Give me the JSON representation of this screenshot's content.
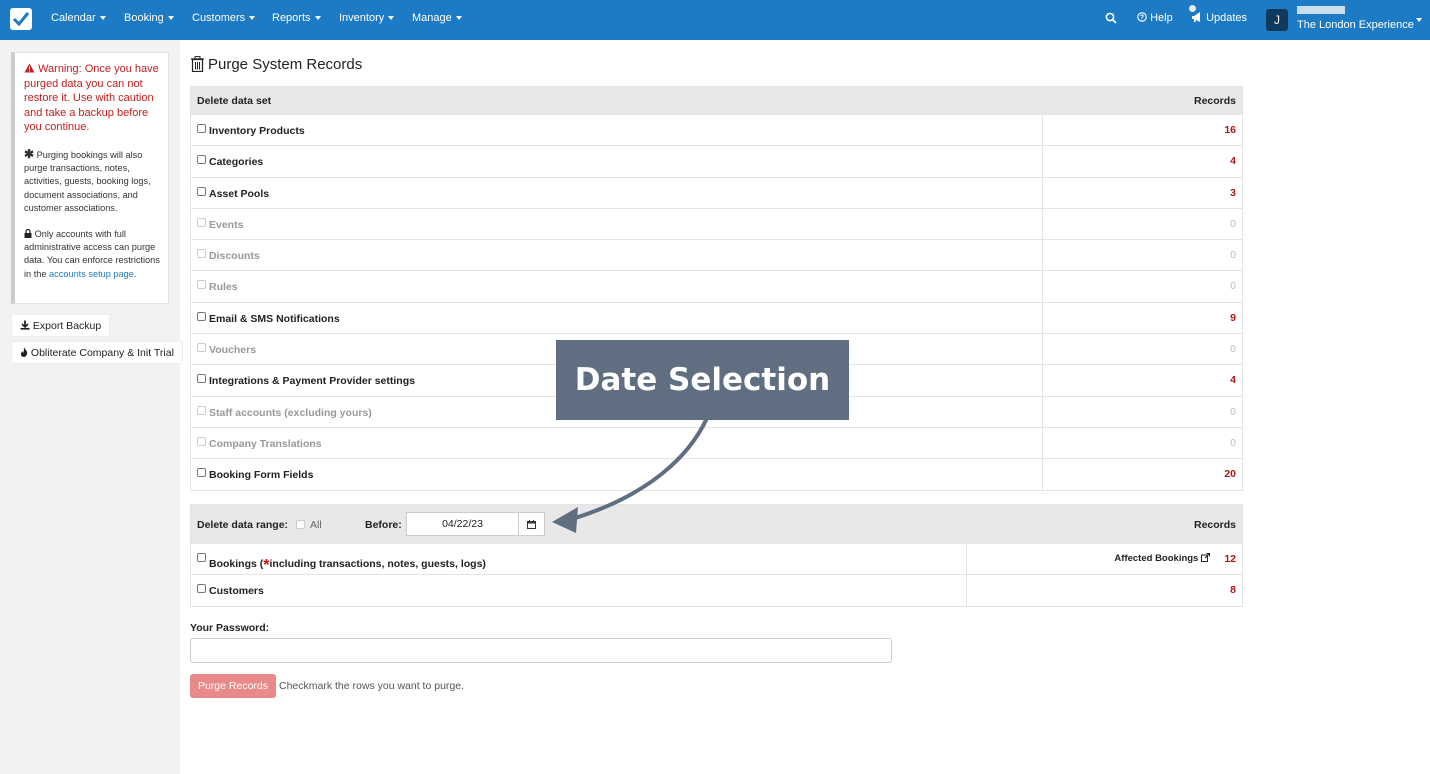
{
  "nav": {
    "items": [
      {
        "label": "Calendar"
      },
      {
        "label": "Booking"
      },
      {
        "label": "Customers"
      },
      {
        "label": "Reports"
      },
      {
        "label": "Inventory"
      },
      {
        "label": "Manage"
      }
    ],
    "help": "Help",
    "updates": "Updates",
    "avatar_initial": "J",
    "company": "The London Experience"
  },
  "sidebar": {
    "warning": "Warning: Once you have purged data you can not restore it. Use with caution and take a backup before you continue.",
    "note1": "Purging bookings will also purge transactions, notes, activities, guests, booking logs, document associations, and customer associations.",
    "note2_prefix": "Only accounts with full administrative access can purge data. You can enforce restrictions in the",
    "note2_link": "accounts setup page",
    "note2_suffix": ".",
    "export_label": "Export Backup",
    "obliterate_label": "Obliterate Company & Init Trial"
  },
  "page": {
    "title": "Purge System Records"
  },
  "dataset_table": {
    "header_left": "Delete data set",
    "header_right": "Records",
    "rows": [
      {
        "label": "Inventory Products",
        "count": "16",
        "disabled": false
      },
      {
        "label": "Categories",
        "count": "4",
        "disabled": false
      },
      {
        "label": "Asset Pools",
        "count": "3",
        "disabled": false
      },
      {
        "label": "Events",
        "count": "0",
        "disabled": true
      },
      {
        "label": "Discounts",
        "count": "0",
        "disabled": true
      },
      {
        "label": "Rules",
        "count": "0",
        "disabled": true
      },
      {
        "label": "Email & SMS Notifications",
        "count": "9",
        "disabled": false
      },
      {
        "label": "Vouchers",
        "count": "0",
        "disabled": true
      },
      {
        "label": "Integrations & Payment Provider settings",
        "count": "4",
        "disabled": false
      },
      {
        "label": "Staff accounts (excluding yours)",
        "count": "0",
        "disabled": true
      },
      {
        "label": "Company Translations",
        "count": "0",
        "disabled": true
      },
      {
        "label": "Booking Form Fields",
        "count": "20",
        "disabled": false
      }
    ]
  },
  "range_table": {
    "header_label": "Delete data range:",
    "all_label": "All",
    "before_label": "Before:",
    "date_value": "04/22/23",
    "header_right": "Records",
    "bookings_prefix": "Bookings (",
    "bookings_star": "*",
    "bookings_suffix": "including transactions, notes, guests, logs)",
    "affected_label": "Affected Bookings",
    "bookings_count": "12",
    "customers_label": "Customers",
    "customers_count": "8"
  },
  "password": {
    "label": "Your Password:",
    "value": ""
  },
  "purge": {
    "button_label": "Purge Records",
    "hint": "Checkmark the rows you want to purge."
  },
  "annotation": {
    "text": "Date Selection"
  },
  "colors": {
    "navbar": "#1c7bc4",
    "warning": "#c02020",
    "count": "#b01515",
    "purge_button": "#e88a8a",
    "annotation": "#5f6e80"
  }
}
